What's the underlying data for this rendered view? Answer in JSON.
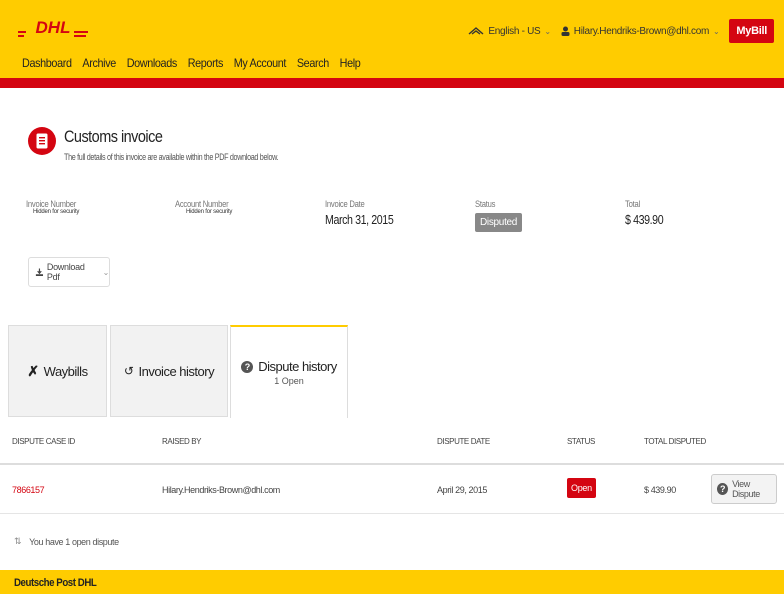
{
  "header": {
    "logo_text": "DHL",
    "language": "English - US",
    "user": "Hilary.Hendriks-Brown@dhl.com",
    "mybill": "MyBill",
    "nav": [
      "Dashboard",
      "Archive",
      "Downloads",
      "Reports",
      "My Account",
      "Search",
      "Help"
    ]
  },
  "invoice": {
    "title": "Customs invoice",
    "subtitle": "The full details of this invoice are available within the PDF download below.",
    "fields": {
      "invoice_number_label": "Invoice Number",
      "invoice_number_value": "Hidden for security",
      "account_number_label": "Account Number",
      "account_number_value": "Hidden for security",
      "invoice_date_label": "Invoice Date",
      "invoice_date_value": "March 31, 2015",
      "status_label": "Status",
      "status_value": "Disputed",
      "total_label": "Total",
      "total_value": "$ 439.90"
    },
    "download_label": "Download Pdf"
  },
  "tabs": [
    {
      "label": "Waybills",
      "sub": ""
    },
    {
      "label": "Invoice history",
      "sub": ""
    },
    {
      "label": "Dispute history",
      "sub": "1 Open"
    }
  ],
  "table": {
    "headers": [
      "Dispute Case ID",
      "Raised By",
      "Dispute Date",
      "Status",
      "Total Disputed"
    ],
    "rows": [
      {
        "case_id": "7866157",
        "raised_by": "Hilary.Hendriks-Brown@dhl.com",
        "date": "April 29, 2015",
        "status": "Open",
        "total": "$ 439.90",
        "action": "View Dispute"
      }
    ]
  },
  "summary": "You have 1 open dispute",
  "footer": "Deutsche Post DHL",
  "colors": {
    "brand_yellow": "#ffcc00",
    "brand_red": "#d40511"
  }
}
